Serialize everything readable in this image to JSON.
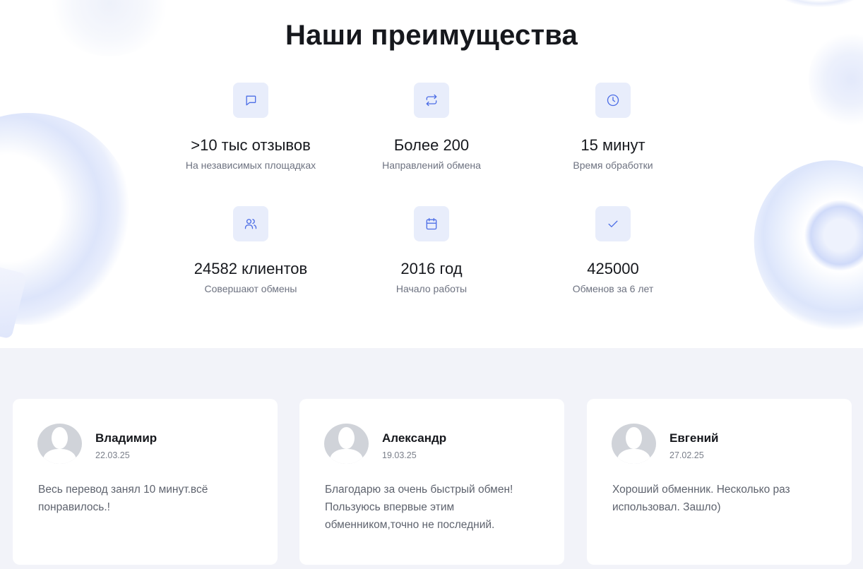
{
  "advantages": {
    "title": "Наши преимущества",
    "items": [
      {
        "icon": "chat-bubble-icon",
        "value": ">10 тыс отзывов",
        "description": "На независимых площадках"
      },
      {
        "icon": "exchange-arrows-icon",
        "value": "Более 200",
        "description": "Направлений обмена"
      },
      {
        "icon": "clock-icon",
        "value": "15 минут",
        "description": "Время обработки"
      },
      {
        "icon": "users-icon",
        "value": "24582 клиентов",
        "description": "Совершают обмены"
      },
      {
        "icon": "calendar-icon",
        "value": "2016 год",
        "description": "Начало работы"
      },
      {
        "icon": "checkmark-icon",
        "value": "425000",
        "description": "Обменов за 6 лет"
      }
    ]
  },
  "reviews": [
    {
      "name": "Владимир",
      "date": "22.03.25",
      "text": "Весь перевод занял 10 минут.всё понравилось.!"
    },
    {
      "name": "Александр",
      "date": "19.03.25",
      "text": "Благодарю за очень быстрый обмен! Пользуюсь впервые этим обменником,точно не последний."
    },
    {
      "name": "Евгений",
      "date": "27.02.25",
      "text": "Хороший обменник. Несколько раз использовал. Зашло)"
    }
  ],
  "colors": {
    "accent": "#4d6ee6",
    "icon_bg": "#e8edfb",
    "reviews_bg": "#f2f3f9",
    "avatar": "#d0d3d9"
  }
}
